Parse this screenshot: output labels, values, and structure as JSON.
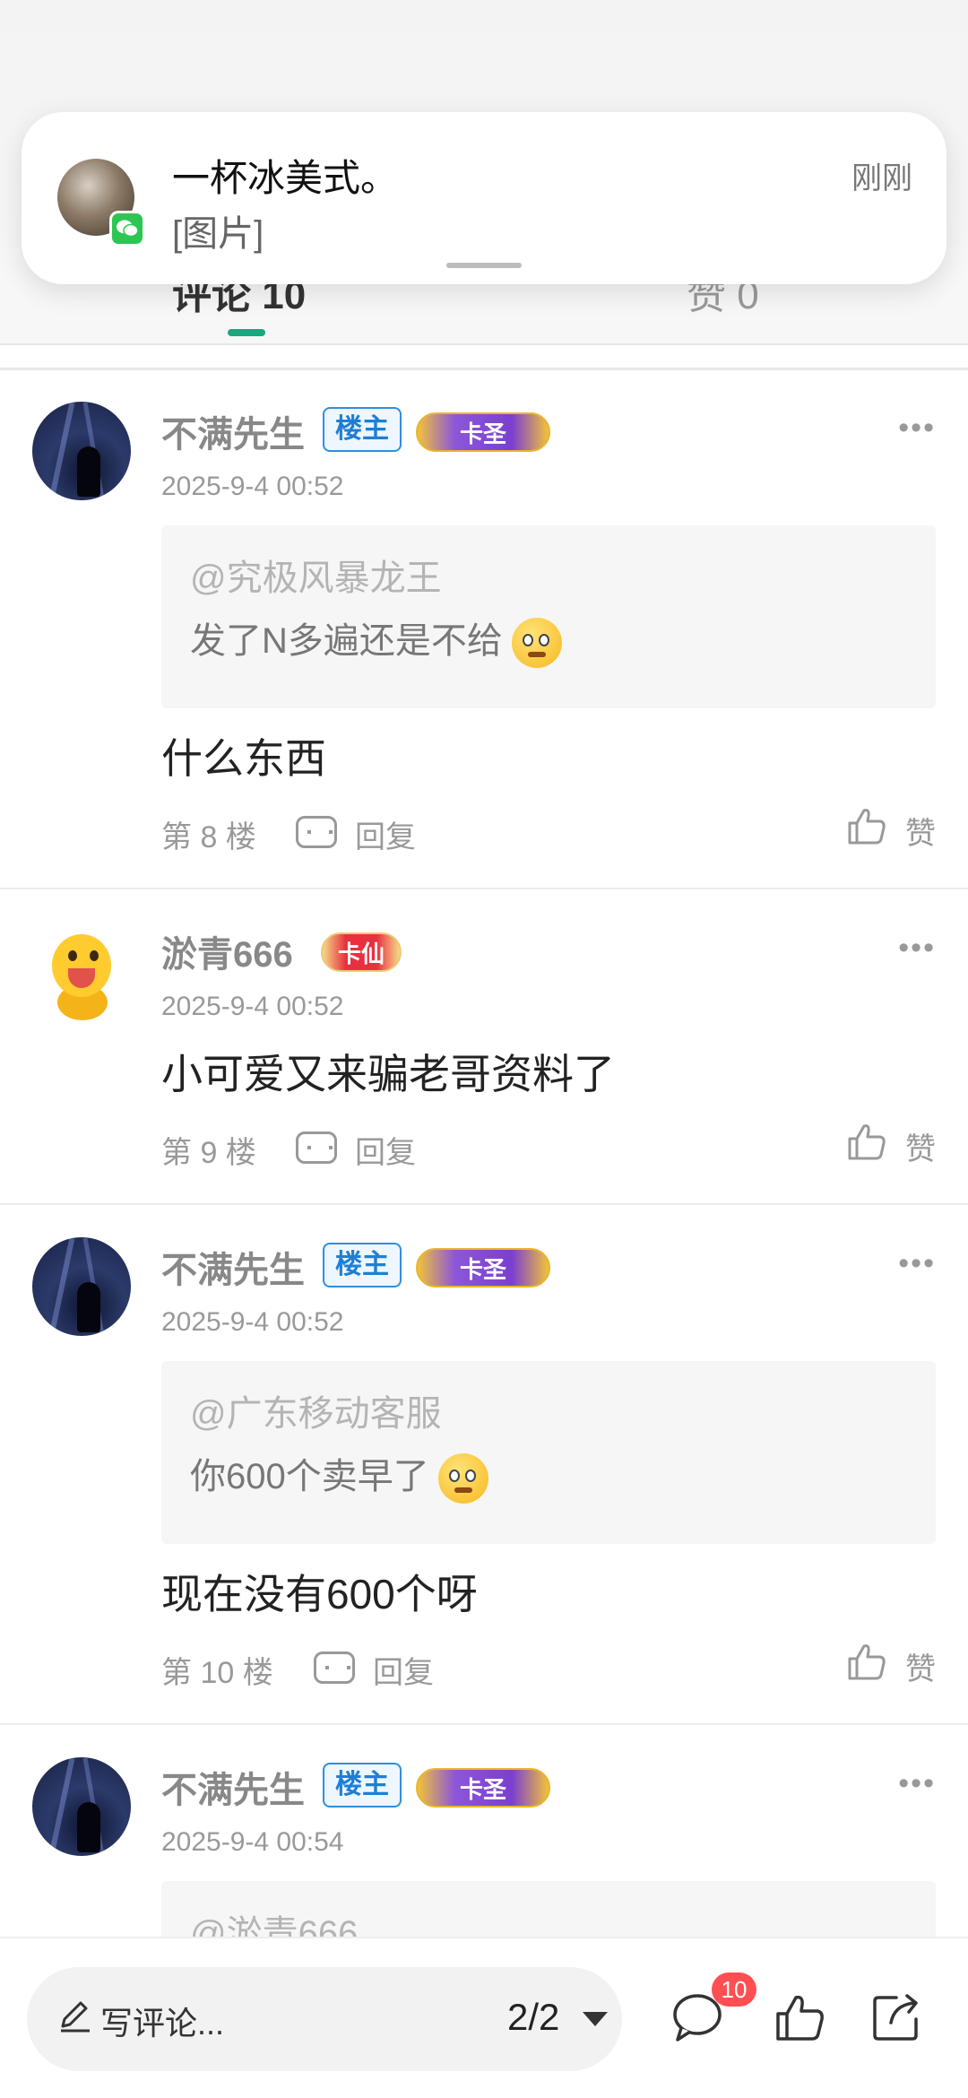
{
  "notification": {
    "title": "一杯冰美式。",
    "body": "[图片]",
    "time": "刚刚",
    "app_icon": "wechat-icon"
  },
  "tabs": [
    {
      "label": "评论 10"
    },
    {
      "label": "赞 0"
    }
  ],
  "comments": [
    {
      "username": "不满先生",
      "owner_badge": "楼主",
      "rank_badge": "卡圣",
      "time": "2025-9-4 00:52",
      "quote_at": "@究极风暴龙王",
      "quote_text": "发了N多遍还是不给",
      "text": "什么东西",
      "floor": "第 8 楼",
      "reply": "回复",
      "like": "赞"
    },
    {
      "username": "淤青666",
      "rank_badge": "卡仙",
      "time": "2025-9-4 00:52",
      "text": "小可爱又来骗老哥资料了",
      "floor": "第 9 楼",
      "reply": "回复",
      "like": "赞"
    },
    {
      "username": "不满先生",
      "owner_badge": "楼主",
      "rank_badge": "卡圣",
      "time": "2025-9-4 00:52",
      "quote_at": "@广东移动客服",
      "quote_text": "你600个卖早了",
      "text": "现在没有600个呀",
      "floor": "第 10 楼",
      "reply": "回复",
      "like": "赞"
    },
    {
      "username": "不满先生",
      "owner_badge": "楼主",
      "rank_badge": "卡圣",
      "time": "2025-9-4 00:54",
      "quote_at": "@淤青666"
    }
  ],
  "bottom_bar": {
    "write_placeholder": "写评论...",
    "page": "2/2",
    "comment_count": "10",
    "icons": [
      "comment-icon",
      "thumbs-up-icon",
      "share-icon"
    ]
  },
  "colors": {
    "accent": "#1aa67e",
    "owner_badge": "#2e8fe0",
    "count_badge": "#ff4f52"
  }
}
